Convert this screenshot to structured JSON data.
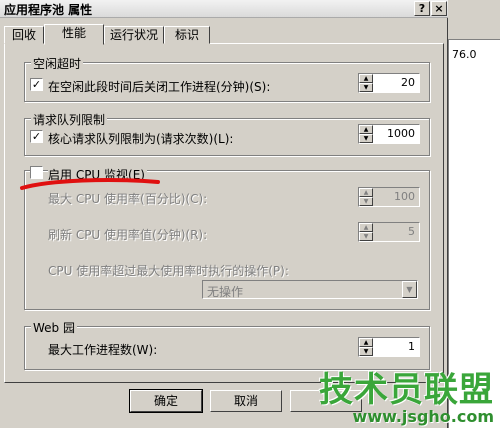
{
  "window": {
    "title": "应用程序池 属性",
    "help_btn": "?",
    "close_btn": "×"
  },
  "tabs": [
    {
      "label": "回收"
    },
    {
      "label": "性能"
    },
    {
      "label": "运行状况"
    },
    {
      "label": "标识"
    }
  ],
  "idle": {
    "title": "空闲超时",
    "checkbox_label": "在空闲此段时间后关闭工作进程(分钟)(S):",
    "checked": true,
    "value": "20"
  },
  "queue": {
    "title": "请求队列限制",
    "checkbox_label": "核心请求队列限制为(请求次数)(L):",
    "checked": true,
    "value": "1000"
  },
  "cpu": {
    "checkbox_label": "启用 CPU 监视(E)",
    "checked": false,
    "max_label": "最大 CPU 使用率(百分比)(C):",
    "max_value": "100",
    "refresh_label": "刷新 CPU 使用率值(分钟)(R):",
    "refresh_value": "5",
    "action_label": "CPU 使用率超过最大使用率时执行的操作(P):",
    "action_value": "无操作"
  },
  "web_garden": {
    "title": "Web 园",
    "label": "最大工作进程数(W):",
    "value": "1"
  },
  "buttons": {
    "ok": "确定",
    "cancel": "取消"
  },
  "background": {
    "text": "76.0"
  },
  "watermark": {
    "big": "技术员联盟",
    "small": "www.jsgho.com"
  },
  "colors": {
    "annotation_red": "#e01010",
    "watermark_green": "#3aa63a"
  }
}
